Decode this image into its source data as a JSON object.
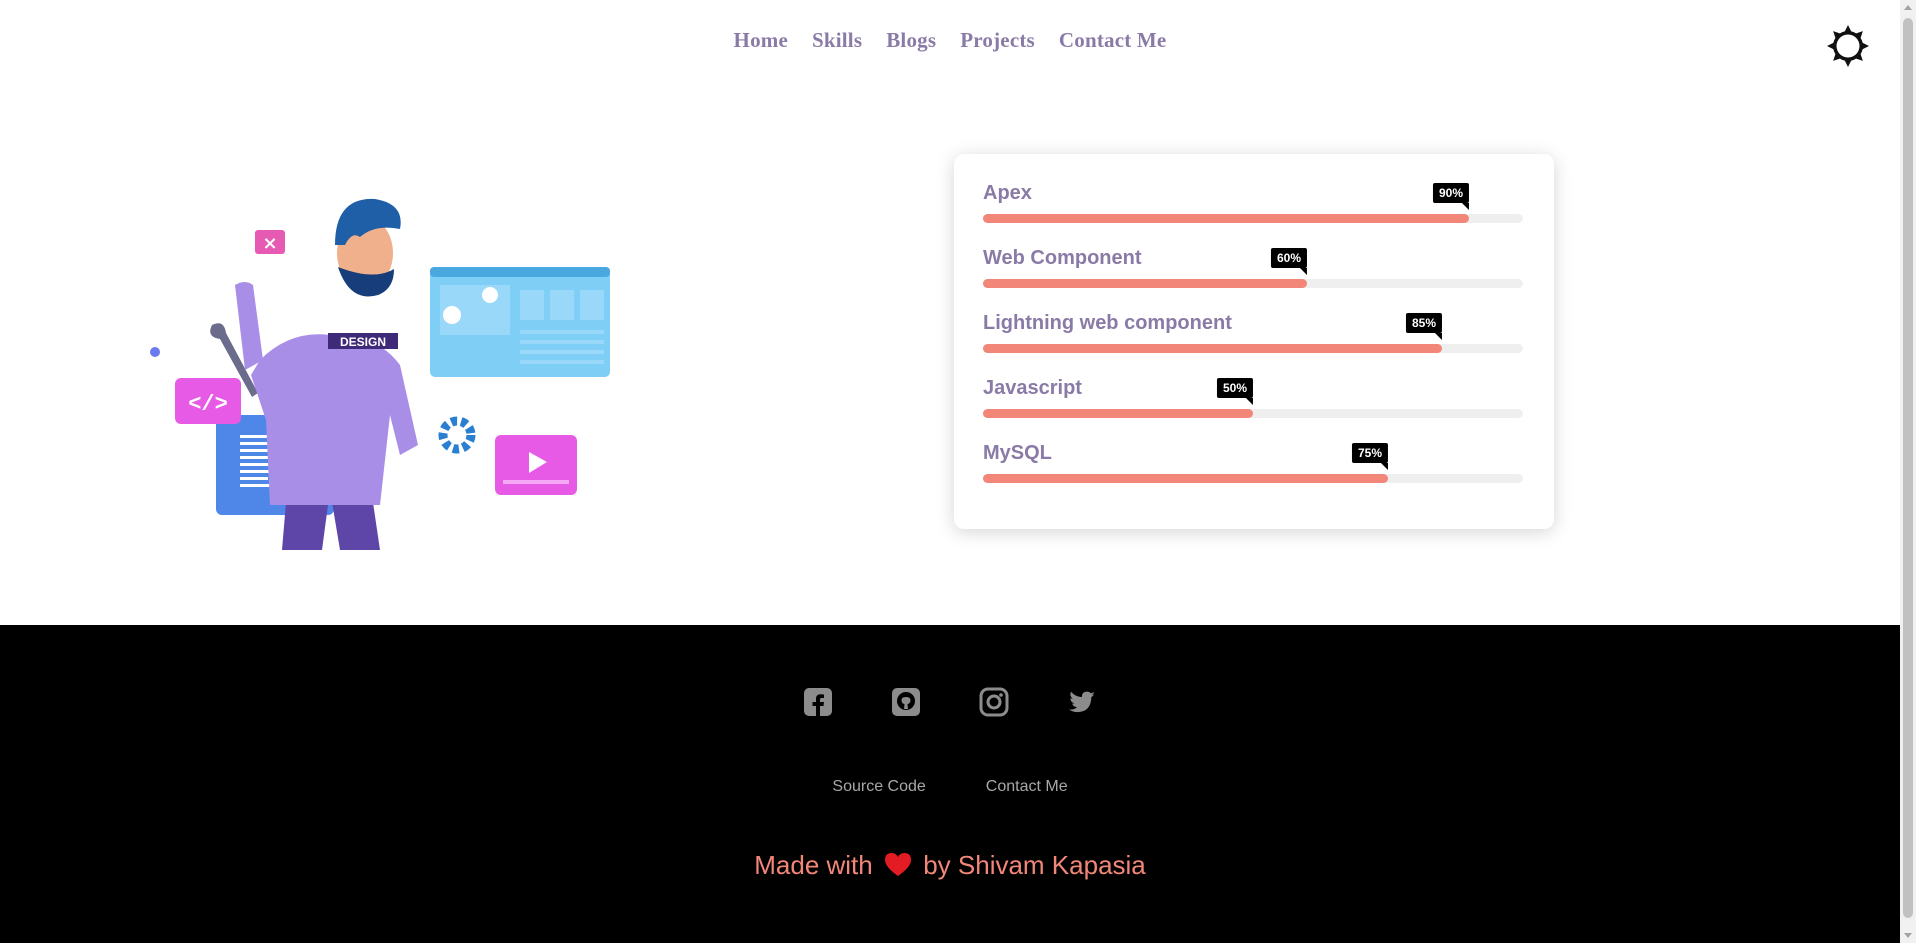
{
  "nav": {
    "links": [
      "Home",
      "Skills",
      "Blogs",
      "Projects",
      "Contact Me"
    ],
    "theme_icon": "sun-icon"
  },
  "illustration": {
    "badge_text": "DESIGN",
    "code_icon_text": "</>"
  },
  "skills": [
    {
      "label": "Apex",
      "percent": 90,
      "percent_label": "90%"
    },
    {
      "label": "Web Component",
      "percent": 60,
      "percent_label": "60%"
    },
    {
      "label": "Lightning web component",
      "percent": 85,
      "percent_label": "85%"
    },
    {
      "label": "Javascript",
      "percent": 50,
      "percent_label": "50%"
    },
    {
      "label": "MySQL",
      "percent": 75,
      "percent_label": "75%"
    }
  ],
  "colors": {
    "accent": "#f28779",
    "nav_text": "#8a7aa6",
    "footer_bg": "#000000",
    "footer_icon": "#8c8c8c"
  },
  "footer": {
    "social_icons": [
      "facebook-icon",
      "github-icon",
      "instagram-icon",
      "twitter-icon"
    ],
    "links": [
      "Source Code",
      "Contact Me"
    ],
    "made_prefix": "Made with",
    "made_suffix": "by Shivam Kapasia"
  }
}
